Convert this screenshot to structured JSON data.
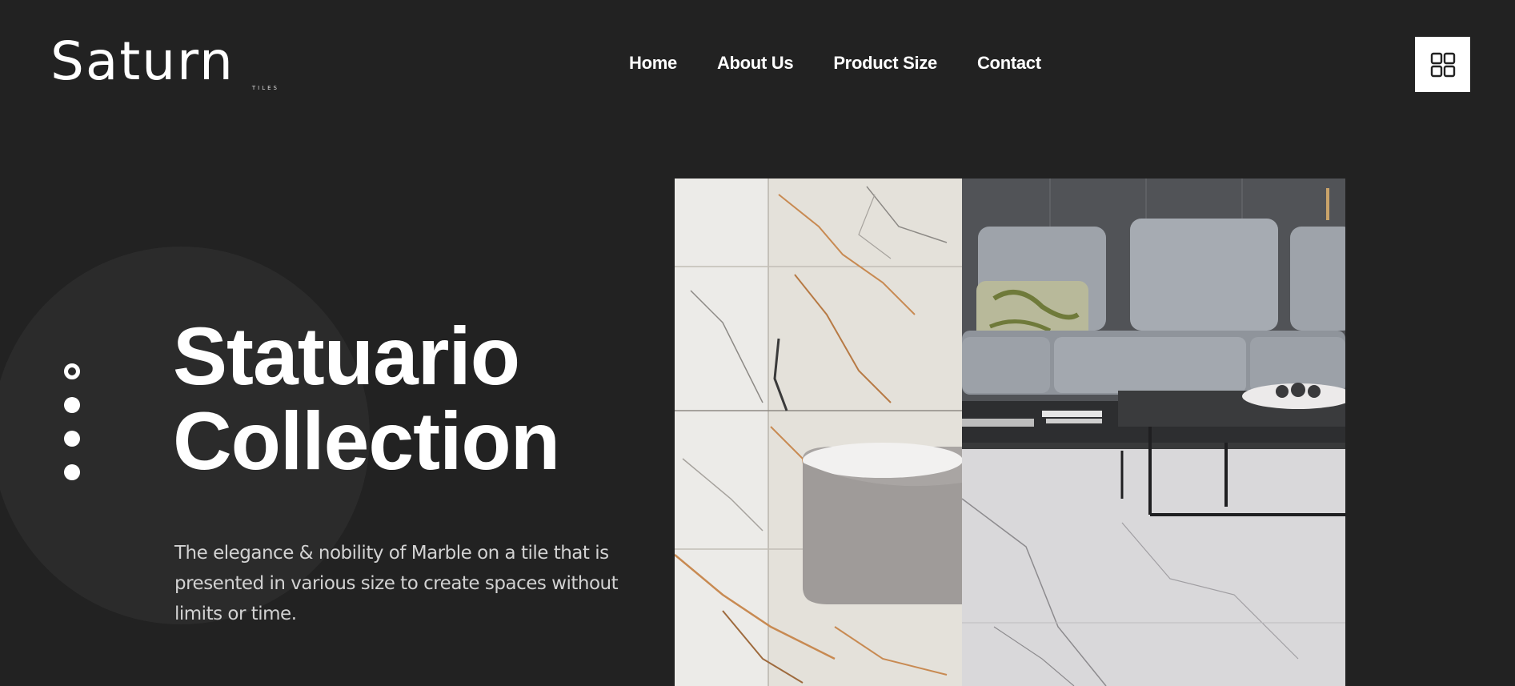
{
  "brand": {
    "name": "Saturn",
    "sub": "TILES"
  },
  "nav": {
    "items": [
      {
        "label": "Home"
      },
      {
        "label": "About Us"
      },
      {
        "label": "Product Size"
      },
      {
        "label": "Contact"
      }
    ]
  },
  "menu": {
    "icon": "grid-icon"
  },
  "hero": {
    "title_line1": "Statuario",
    "title_line2": "Collection",
    "description": "The elegance & nobility of Marble on a tile that is presented in various size to create spaces without limits or time.",
    "slides": {
      "count": 4,
      "active": 1
    }
  },
  "gallery": {
    "images": [
      {
        "name": "marble-bathroom-image"
      },
      {
        "name": "living-room-image"
      }
    ]
  },
  "colors": {
    "background": "#222222",
    "text": "#ffffff",
    "muted_text": "#d2d2d2"
  }
}
